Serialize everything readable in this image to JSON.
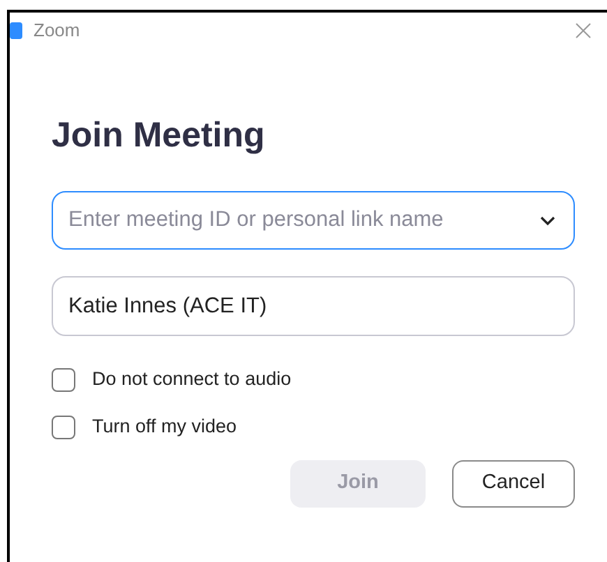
{
  "window": {
    "title": "Zoom"
  },
  "heading": "Join Meeting",
  "meeting_field": {
    "placeholder": "Enter meeting ID or personal link name",
    "focused": true
  },
  "name_field": {
    "value": "Katie Innes (ACE IT)"
  },
  "options": [
    {
      "label": "Do not connect to audio",
      "checked": false
    },
    {
      "label": "Turn off my video",
      "checked": false
    }
  ],
  "buttons": [
    {
      "label": "Join",
      "kind": "primary",
      "disabled": true
    },
    {
      "label": "Cancel",
      "kind": "secondary",
      "disabled": false
    }
  ]
}
